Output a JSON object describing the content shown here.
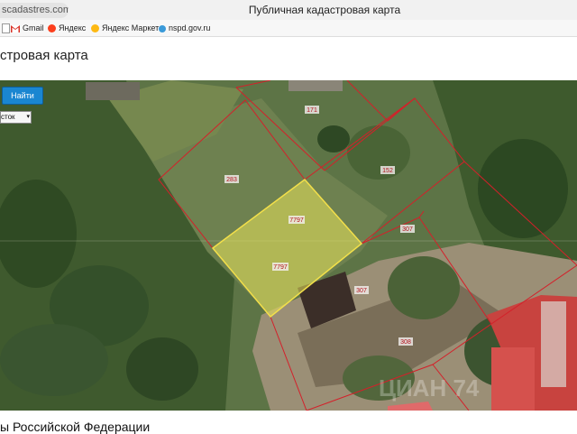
{
  "browser": {
    "url_fragment": "scadastres.com",
    "window_title": "Публичная кадастровая карта"
  },
  "bookmarks": [
    {
      "label": "Gmail",
      "icon": "gmail-icon"
    },
    {
      "label": "Яндекс",
      "icon": "yandex-icon"
    },
    {
      "label": "Яндекс Маркет",
      "icon": "yandex-market-icon"
    },
    {
      "label": "nspd.gov.ru",
      "icon": "nspd-icon"
    }
  ],
  "page": {
    "title": "стровая карта",
    "footer_text": "ы Российской Федерации"
  },
  "controls": {
    "search_button": "Найти",
    "type_select": "сток"
  },
  "map": {
    "parcels": [
      "171",
      "283",
      "152",
      "7797",
      "7797",
      "307",
      "307",
      "308"
    ],
    "highlight_color": "#e9e35a",
    "border_color": "#d4202a"
  },
  "watermark": "ЦИАН 74"
}
